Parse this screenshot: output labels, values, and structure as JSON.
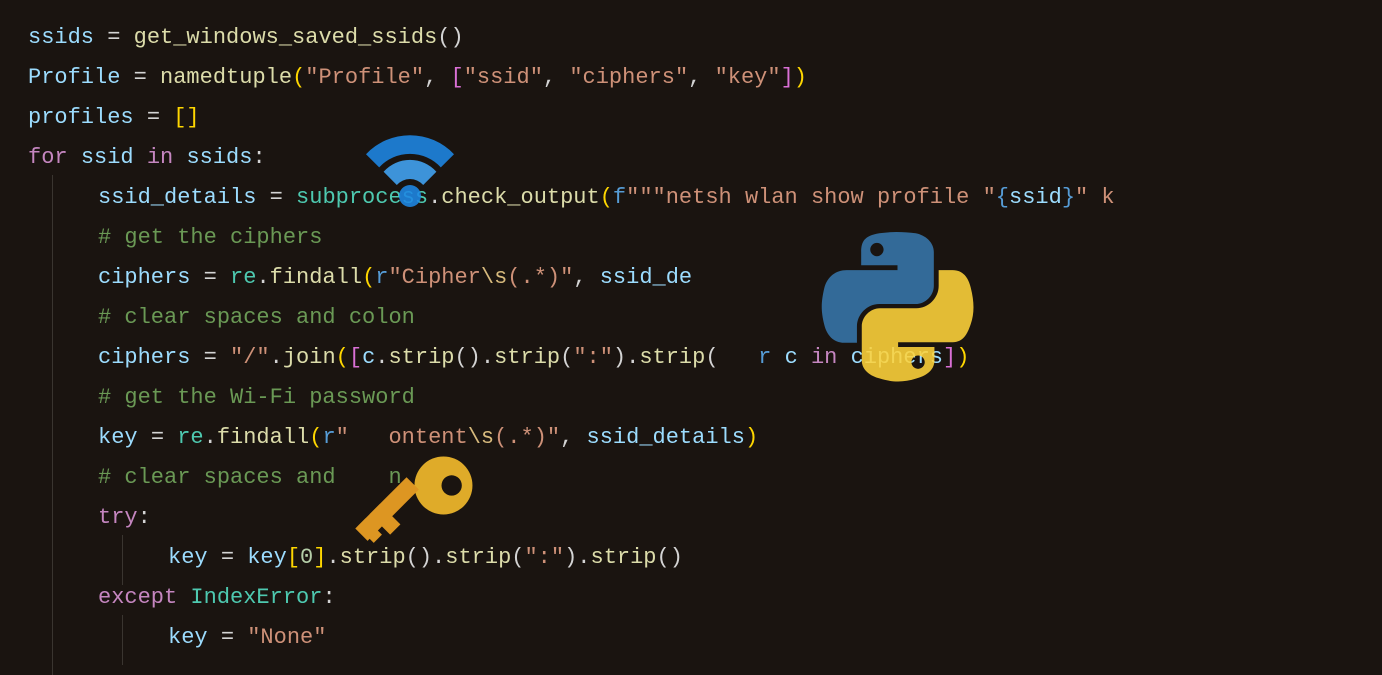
{
  "code": {
    "lines": [
      {
        "indent": 0,
        "tokens": [
          {
            "t": "ssids",
            "c": "t-var"
          },
          {
            "t": " ",
            "c": "t-op"
          },
          {
            "t": "=",
            "c": "t-op"
          },
          {
            "t": " ",
            "c": "t-op"
          },
          {
            "t": "get_windows_saved_ssids",
            "c": "t-func"
          },
          {
            "t": "()",
            "c": "t-punct"
          }
        ]
      },
      {
        "indent": 0,
        "tokens": [
          {
            "t": "Profile",
            "c": "t-var"
          },
          {
            "t": " ",
            "c": "t-op"
          },
          {
            "t": "=",
            "c": "t-op"
          },
          {
            "t": " ",
            "c": "t-op"
          },
          {
            "t": "namedtuple",
            "c": "t-func"
          },
          {
            "t": "(",
            "c": "t-bracket"
          },
          {
            "t": "\"Profile\"",
            "c": "t-str"
          },
          {
            "t": ", ",
            "c": "t-punct"
          },
          {
            "t": "[",
            "c": "t-bracket2"
          },
          {
            "t": "\"ssid\"",
            "c": "t-str"
          },
          {
            "t": ", ",
            "c": "t-punct"
          },
          {
            "t": "\"ciphers\"",
            "c": "t-str"
          },
          {
            "t": ", ",
            "c": "t-punct"
          },
          {
            "t": "\"key\"",
            "c": "t-str"
          },
          {
            "t": "]",
            "c": "t-bracket2"
          },
          {
            "t": ")",
            "c": "t-bracket"
          }
        ]
      },
      {
        "indent": 0,
        "tokens": [
          {
            "t": "profiles",
            "c": "t-var"
          },
          {
            "t": " ",
            "c": "t-op"
          },
          {
            "t": "=",
            "c": "t-op"
          },
          {
            "t": " ",
            "c": "t-op"
          },
          {
            "t": "[]",
            "c": "t-bracket"
          }
        ]
      },
      {
        "indent": 0,
        "tokens": [
          {
            "t": "for",
            "c": "t-kw"
          },
          {
            "t": " ",
            "c": "t-op"
          },
          {
            "t": "ssid",
            "c": "t-var"
          },
          {
            "t": " ",
            "c": "t-op"
          },
          {
            "t": "in",
            "c": "t-kw"
          },
          {
            "t": " ",
            "c": "t-op"
          },
          {
            "t": "ssids",
            "c": "t-var"
          },
          {
            "t": ":",
            "c": "t-punct"
          }
        ]
      },
      {
        "indent": 1,
        "tokens": [
          {
            "t": "ssid_details",
            "c": "t-var"
          },
          {
            "t": " ",
            "c": "t-op"
          },
          {
            "t": "=",
            "c": "t-op"
          },
          {
            "t": " ",
            "c": "t-op"
          },
          {
            "t": "subprocess",
            "c": "t-mod"
          },
          {
            "t": ".",
            "c": "t-punct"
          },
          {
            "t": "check_output",
            "c": "t-func"
          },
          {
            "t": "(",
            "c": "t-bracket"
          },
          {
            "t": "f",
            "c": "t-fstr"
          },
          {
            "t": "\"\"\"netsh wlan show profile \"",
            "c": "t-str"
          },
          {
            "t": "{",
            "c": "t-fstr"
          },
          {
            "t": "ssid",
            "c": "t-var"
          },
          {
            "t": "}",
            "c": "t-fstr"
          },
          {
            "t": "\" k",
            "c": "t-str"
          }
        ]
      },
      {
        "indent": 1,
        "tokens": [
          {
            "t": "# get the ciphers",
            "c": "t-cmt"
          }
        ]
      },
      {
        "indent": 1,
        "tokens": [
          {
            "t": "ciphers",
            "c": "t-var"
          },
          {
            "t": " ",
            "c": "t-op"
          },
          {
            "t": "=",
            "c": "t-op"
          },
          {
            "t": " ",
            "c": "t-op"
          },
          {
            "t": "re",
            "c": "t-mod"
          },
          {
            "t": ".",
            "c": "t-punct"
          },
          {
            "t": "findall",
            "c": "t-func"
          },
          {
            "t": "(",
            "c": "t-bracket"
          },
          {
            "t": "r",
            "c": "t-fstr"
          },
          {
            "t": "\"Cipher",
            "c": "t-str"
          },
          {
            "t": "\\s",
            "c": "t-escp"
          },
          {
            "t": "(.*)\"",
            "c": "t-str"
          },
          {
            "t": ", ",
            "c": "t-punct"
          },
          {
            "t": "ssid_de",
            "c": "t-var"
          }
        ]
      },
      {
        "indent": 1,
        "tokens": [
          {
            "t": "# clear spaces and colon",
            "c": "t-cmt"
          }
        ]
      },
      {
        "indent": 1,
        "tokens": [
          {
            "t": "ciphers",
            "c": "t-var"
          },
          {
            "t": " ",
            "c": "t-op"
          },
          {
            "t": "=",
            "c": "t-op"
          },
          {
            "t": " ",
            "c": "t-op"
          },
          {
            "t": "\"/\"",
            "c": "t-str"
          },
          {
            "t": ".",
            "c": "t-punct"
          },
          {
            "t": "join",
            "c": "t-func"
          },
          {
            "t": "(",
            "c": "t-bracket"
          },
          {
            "t": "[",
            "c": "t-bracket2"
          },
          {
            "t": "c",
            "c": "t-var"
          },
          {
            "t": ".",
            "c": "t-punct"
          },
          {
            "t": "strip",
            "c": "t-func"
          },
          {
            "t": "().",
            "c": "t-punct"
          },
          {
            "t": "strip",
            "c": "t-func"
          },
          {
            "t": "(",
            "c": "t-punct"
          },
          {
            "t": "\":\"",
            "c": "t-str"
          },
          {
            "t": ").",
            "c": "t-punct"
          },
          {
            "t": "strip",
            "c": "t-func"
          },
          {
            "t": "(   ",
            "c": "t-punct"
          },
          {
            "t": "r",
            "c": "t-fstr"
          },
          {
            "t": " ",
            "c": "t-op"
          },
          {
            "t": "c",
            "c": "t-var"
          },
          {
            "t": " ",
            "c": "t-op"
          },
          {
            "t": "in",
            "c": "t-kw"
          },
          {
            "t": " ",
            "c": "t-op"
          },
          {
            "t": "ciphers",
            "c": "t-var"
          },
          {
            "t": "]",
            "c": "t-bracket2"
          },
          {
            "t": ")",
            "c": "t-bracket"
          }
        ]
      },
      {
        "indent": 1,
        "tokens": [
          {
            "t": "# get the Wi-Fi password",
            "c": "t-cmt"
          }
        ]
      },
      {
        "indent": 1,
        "tokens": [
          {
            "t": "key",
            "c": "t-var"
          },
          {
            "t": " ",
            "c": "t-op"
          },
          {
            "t": "=",
            "c": "t-op"
          },
          {
            "t": " ",
            "c": "t-op"
          },
          {
            "t": "re",
            "c": "t-mod"
          },
          {
            "t": ".",
            "c": "t-punct"
          },
          {
            "t": "findall",
            "c": "t-func"
          },
          {
            "t": "(",
            "c": "t-bracket"
          },
          {
            "t": "r",
            "c": "t-fstr"
          },
          {
            "t": "\"   ontent",
            "c": "t-str"
          },
          {
            "t": "\\s",
            "c": "t-escp"
          },
          {
            "t": "(.*)\"",
            "c": "t-str"
          },
          {
            "t": ", ",
            "c": "t-punct"
          },
          {
            "t": "ssid_details",
            "c": "t-var"
          },
          {
            "t": ")",
            "c": "t-bracket"
          }
        ]
      },
      {
        "indent": 1,
        "tokens": [
          {
            "t": "# clear spaces and    n",
            "c": "t-cmt"
          }
        ]
      },
      {
        "indent": 1,
        "tokens": [
          {
            "t": "try",
            "c": "t-kw"
          },
          {
            "t": ":",
            "c": "t-punct"
          }
        ]
      },
      {
        "indent": 2,
        "tokens": [
          {
            "t": "key",
            "c": "t-var"
          },
          {
            "t": " ",
            "c": "t-op"
          },
          {
            "t": "=",
            "c": "t-op"
          },
          {
            "t": " ",
            "c": "t-op"
          },
          {
            "t": "key",
            "c": "t-var"
          },
          {
            "t": "[",
            "c": "t-bracket"
          },
          {
            "t": "0",
            "c": "t-num"
          },
          {
            "t": "]",
            "c": "t-bracket"
          },
          {
            "t": ".",
            "c": "t-punct"
          },
          {
            "t": "strip",
            "c": "t-func"
          },
          {
            "t": "().",
            "c": "t-punct"
          },
          {
            "t": "strip",
            "c": "t-func"
          },
          {
            "t": "(",
            "c": "t-punct"
          },
          {
            "t": "\":\"",
            "c": "t-str"
          },
          {
            "t": ").",
            "c": "t-punct"
          },
          {
            "t": "strip",
            "c": "t-func"
          },
          {
            "t": "()",
            "c": "t-punct"
          }
        ]
      },
      {
        "indent": 1,
        "tokens": [
          {
            "t": "except",
            "c": "t-kw"
          },
          {
            "t": " ",
            "c": "t-op"
          },
          {
            "t": "IndexError",
            "c": "t-excl"
          },
          {
            "t": ":",
            "c": "t-punct"
          }
        ]
      },
      {
        "indent": 2,
        "tokens": [
          {
            "t": "key",
            "c": "t-var"
          },
          {
            "t": " ",
            "c": "t-op"
          },
          {
            "t": "=",
            "c": "t-op"
          },
          {
            "t": " ",
            "c": "t-op"
          },
          {
            "t": "\"None\"",
            "c": "t-str"
          }
        ]
      }
    ]
  },
  "icons": {
    "wifi": "wifi-icon",
    "python": "python-logo-icon",
    "key": "key-icon"
  }
}
